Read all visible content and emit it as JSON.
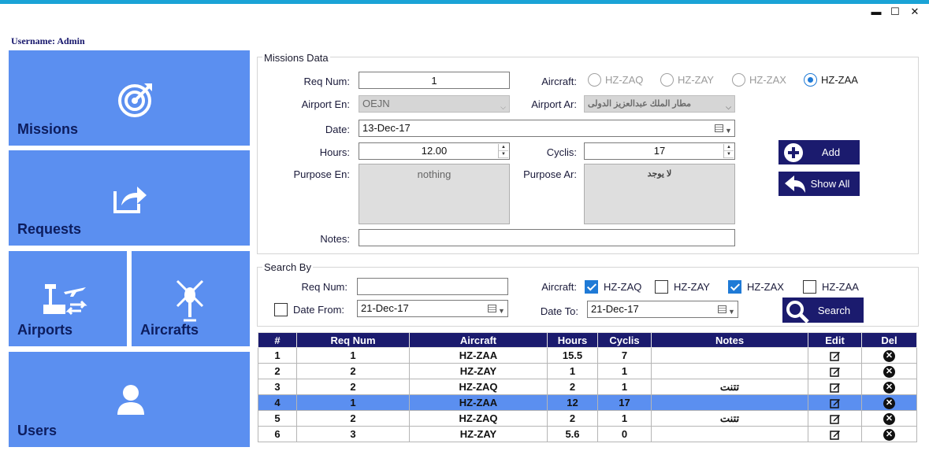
{
  "window": {
    "minimize": "▬",
    "maximize": "☐",
    "close": "✕"
  },
  "username": "Username: Admin",
  "sidebar": {
    "missions": "Missions",
    "requests": "Requests",
    "airports": "Airports",
    "aircrafts": "Aircrafts",
    "users": "Users"
  },
  "missions_data": {
    "title": "Missions Data",
    "req_num_label": "Req Num:",
    "req_num_value": "1",
    "aircraft_label": "Aircraft:",
    "aircraft_options": [
      "HZ-ZAQ",
      "HZ-ZAY",
      "HZ-ZAX",
      "HZ-ZAA"
    ],
    "aircraft_selected": "HZ-ZAA",
    "airport_en_label": "Airport En:",
    "airport_en_value": "OEJN",
    "airport_ar_label": "Airport Ar:",
    "airport_ar_value": "مطار الملك عبدالعزيز الدولى",
    "date_label": "Date:",
    "date_value": "13-Dec-17",
    "hours_label": "Hours:",
    "hours_value": "12.00",
    "cyclis_label": "Cyclis:",
    "cyclis_value": "17",
    "purpose_en_label": "Purpose En:",
    "purpose_en_value": "nothing",
    "purpose_ar_label": "Purpose Ar:",
    "purpose_ar_value": "لا يوجد",
    "notes_label": "Notes:",
    "notes_value": "",
    "add_label": "Add",
    "show_all_label": "Show All"
  },
  "search_by": {
    "title": "Search By",
    "req_num_label": "Req Num:",
    "req_num_value": "",
    "aircraft_label": "Aircraft:",
    "aircraft_checks": [
      {
        "label": "HZ-ZAQ",
        "checked": true
      },
      {
        "label": "HZ-ZAY",
        "checked": false
      },
      {
        "label": "HZ-ZAX",
        "checked": true
      },
      {
        "label": "HZ-ZAA",
        "checked": false
      }
    ],
    "date_from_label": "Date From:",
    "date_from_checked": false,
    "date_from_value": "21-Dec-17",
    "date_to_label": "Date To:",
    "date_to_value": "21-Dec-17",
    "search_label": "Search"
  },
  "table": {
    "headers": [
      "#",
      "Req Num",
      "Aircraft",
      "Hours",
      "Cyclis",
      "Notes",
      "Edit",
      "Del"
    ],
    "selected_row": 3,
    "rows": [
      [
        "1",
        "1",
        "HZ-ZAA",
        "15.5",
        "7",
        ""
      ],
      [
        "2",
        "2",
        "HZ-ZAY",
        "1",
        "1",
        ""
      ],
      [
        "3",
        "2",
        "HZ-ZAQ",
        "2",
        "1",
        "تتنت"
      ],
      [
        "4",
        "1",
        "HZ-ZAA",
        "12",
        "17",
        ""
      ],
      [
        "5",
        "2",
        "HZ-ZAQ",
        "2",
        "1",
        "تتنت"
      ],
      [
        "6",
        "3",
        "HZ-ZAY",
        "5.6",
        "0",
        ""
      ]
    ]
  },
  "colors": {
    "accent": "#1b1b6e",
    "tile": "#5b8ff0",
    "topbar": "#1aa3d6",
    "selected": "#1f7ad6"
  }
}
